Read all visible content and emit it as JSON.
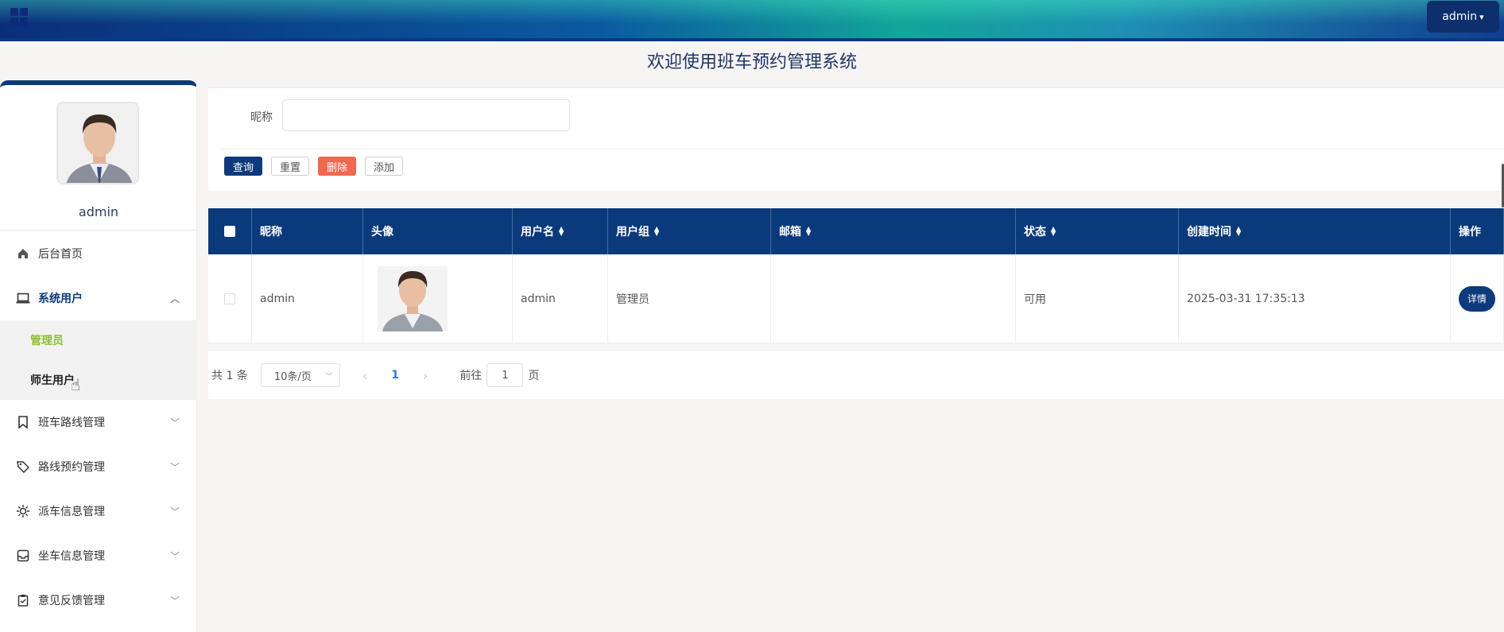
{
  "header": {
    "user_button": "admin",
    "page_title": "欢迎使用班车预约管理系统"
  },
  "sidebar": {
    "username": "admin",
    "items": [
      {
        "label": "后台首页",
        "icon": "home-icon"
      },
      {
        "label": "系统用户",
        "icon": "laptop-icon",
        "expanded": true,
        "children": [
          {
            "label": "管理员",
            "active": true
          },
          {
            "label": "师生用户",
            "active": false
          }
        ]
      },
      {
        "label": "班车路线管理",
        "icon": "bookmark-icon"
      },
      {
        "label": "路线预约管理",
        "icon": "tag-icon"
      },
      {
        "label": "派车信息管理",
        "icon": "sun-icon"
      },
      {
        "label": "坐车信息管理",
        "icon": "inbox-icon"
      },
      {
        "label": "意见反馈管理",
        "icon": "clipboard-check-icon"
      }
    ]
  },
  "search": {
    "nickname_label": "昵称",
    "nickname_value": "",
    "buttons": {
      "query": "查询",
      "reset": "重置",
      "delete": "删除",
      "add": "添加"
    }
  },
  "table": {
    "columns": [
      "昵称",
      "头像",
      "用户名",
      "用户组",
      "邮箱",
      "状态",
      "创建时间",
      "操作"
    ],
    "rows": [
      {
        "nickname": "admin",
        "username": "admin",
        "group": "管理员",
        "email": "",
        "status": "可用",
        "created": "2025-03-31 17:35:13",
        "action": "详情"
      }
    ]
  },
  "pagination": {
    "total": "共 1 条",
    "page_size": "10条/页",
    "current_page": "1",
    "goto_label": "前往",
    "goto_value": "1",
    "page_suffix": "页"
  },
  "colors": {
    "primary": "#0b3a7c",
    "danger": "#f2674f",
    "active_menu": "#8bbf2c"
  }
}
